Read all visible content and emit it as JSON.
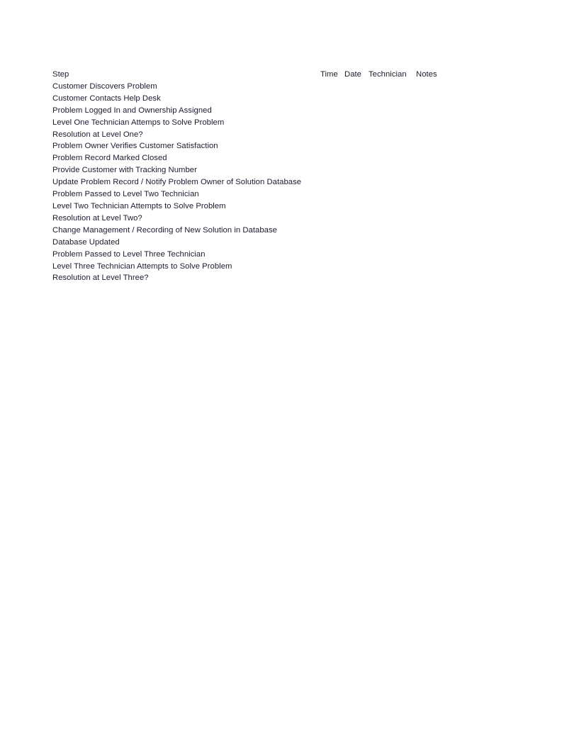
{
  "document": {
    "page_background": "#ffffff",
    "text_color": "#1b1b30"
  },
  "table": {
    "columns": [
      {
        "key": "step",
        "label": "Step"
      },
      {
        "key": "time",
        "label": "Time"
      },
      {
        "key": "date",
        "label": "Date"
      },
      {
        "key": "technician",
        "label": "Technician"
      },
      {
        "key": "notes",
        "label": "Notes"
      }
    ],
    "rows": [
      {
        "step": "Customer Discovers Problem",
        "time": "",
        "date": "",
        "technician": "",
        "notes": ""
      },
      {
        "step": "Customer Contacts Help Desk",
        "time": "",
        "date": "",
        "technician": "",
        "notes": ""
      },
      {
        "step": "Problem Logged In and Ownership Assigned",
        "time": "",
        "date": "",
        "technician": "",
        "notes": ""
      },
      {
        "step": "Level One Technician Attemps to Solve Problem",
        "time": "",
        "date": "",
        "technician": "",
        "notes": ""
      },
      {
        "step": "Resolution at Level One?",
        "time": "",
        "date": "",
        "technician": "",
        "notes": ""
      },
      {
        "step": "Problem Owner Verifies Customer Satisfaction",
        "time": "",
        "date": "",
        "technician": "",
        "notes": ""
      },
      {
        "step": "Problem Record Marked Closed",
        "time": "",
        "date": "",
        "technician": "",
        "notes": ""
      },
      {
        "step": "Provide Customer with Tracking Number",
        "time": "",
        "date": "",
        "technician": "",
        "notes": ""
      },
      {
        "step": "Update Problem Record / Notify Problem Owner of Solution Database",
        "time": "",
        "date": "",
        "technician": "",
        "notes": ""
      },
      {
        "step": "Problem Passed to Level Two Technician",
        "time": "",
        "date": "",
        "technician": "",
        "notes": ""
      },
      {
        "step": "Level Two Technician Attempts to Solve Problem",
        "time": "",
        "date": "",
        "technician": "",
        "notes": ""
      },
      {
        "step": "Resolution at Level Two?",
        "time": "",
        "date": "",
        "technician": "",
        "notes": ""
      },
      {
        "step": "Change Management / Recording of New Solution in Database",
        "time": "",
        "date": "",
        "technician": "",
        "notes": ""
      },
      {
        "step": "Database Updated",
        "time": "",
        "date": "",
        "technician": "",
        "notes": ""
      },
      {
        "step": "Problem Passed to Level Three Technician",
        "time": "",
        "date": "",
        "technician": "",
        "notes": ""
      },
      {
        "step": "Level Three Technician Attempts to Solve Problem",
        "time": "",
        "date": "",
        "technician": "",
        "notes": ""
      },
      {
        "step": "Resolution at Level Three?",
        "time": "",
        "date": "",
        "technician": "",
        "notes": ""
      }
    ]
  }
}
